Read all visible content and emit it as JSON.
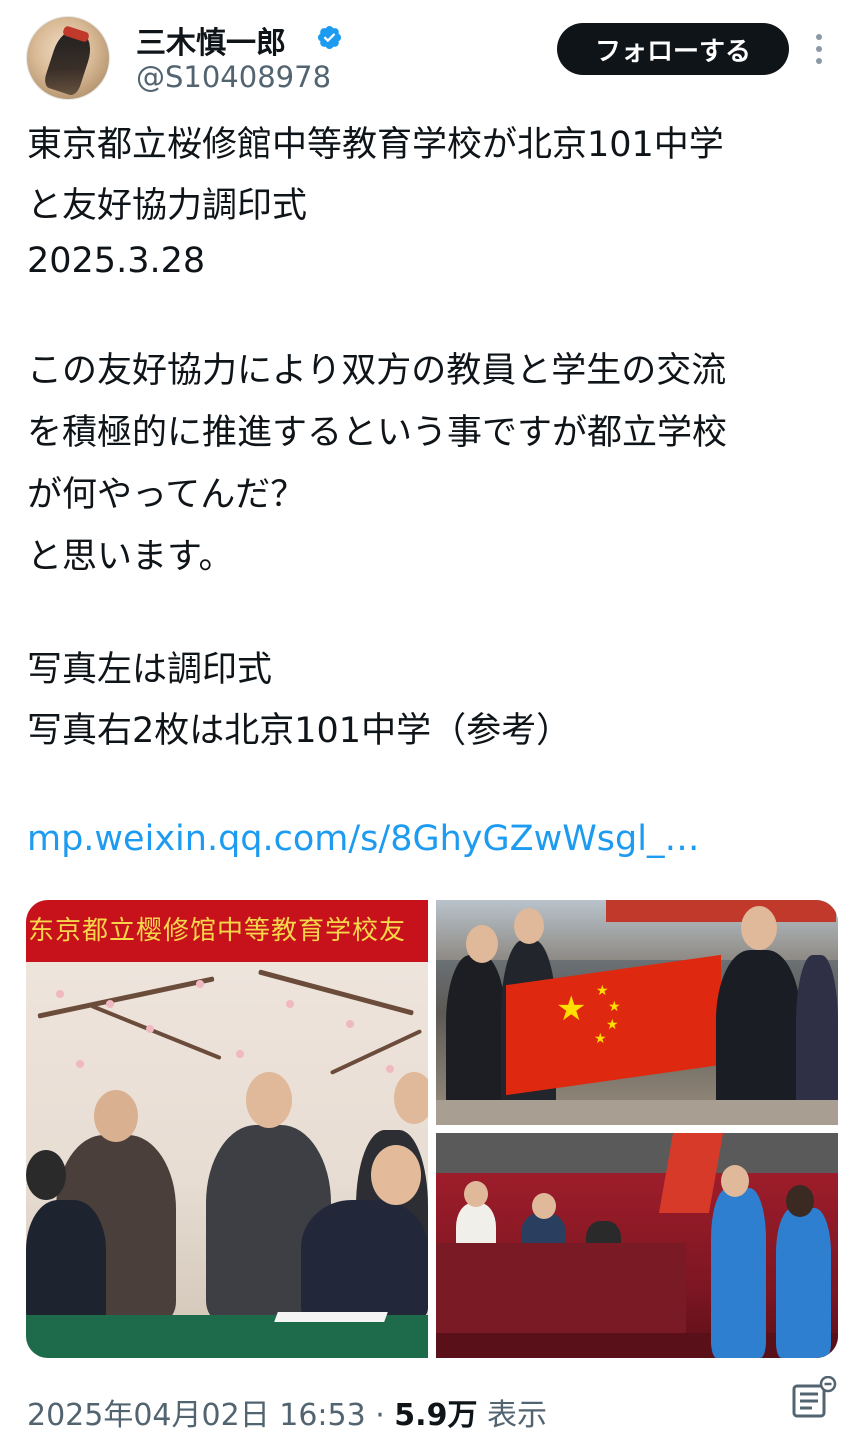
{
  "author": {
    "name": "三木慎一郎",
    "handle": "@S10408978",
    "verified": true
  },
  "follow_button": "フォローする",
  "tweet": {
    "lines": [
      "東京都立桜修館中等教育学校が北京101中学",
      "と友好協力調印式",
      "2025.3.28",
      "この友好協力により双方の教員と学生の交流",
      "を積極的に推進するという事ですが都立学校",
      "が何やってんだ？",
      "と思います。",
      "写真左は調印式",
      "写真右2枚は北京101中学（参考）"
    ],
    "link": "mp.weixin.qq.com/s/8GhyGZwWsgl_…"
  },
  "media": {
    "photo1_banner": "东京都立樱修馆中等教育学校友"
  },
  "footer": {
    "timestamp": "2025年04月02日 16:53",
    "separator": " · ",
    "views": "5.9万",
    "views_label": "表示"
  },
  "colors": {
    "accent": "#1d9bf0",
    "follow_bg": "#0f1419",
    "secondary_text": "#536471"
  }
}
